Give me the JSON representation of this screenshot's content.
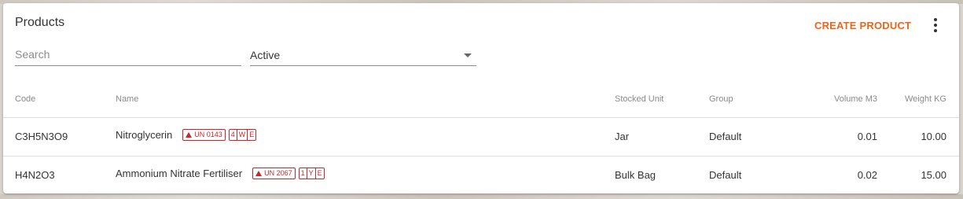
{
  "header": {
    "title": "Products",
    "create_label": "CREATE PRODUCT",
    "more_icon": "more-vertical-icon"
  },
  "filters": {
    "search_placeholder": "Search",
    "search_value": "",
    "status_value": "Active"
  },
  "columns": {
    "code": "Code",
    "name": "Name",
    "stocked_unit": "Stocked Unit",
    "group": "Group",
    "volume": "Volume M3",
    "weight": "Weight KG"
  },
  "rows": [
    {
      "code": "C3H5N3O9",
      "name": "Nitroglycerin",
      "un_badge": "UN 0143",
      "hazard_codes": [
        "4",
        "W",
        "E"
      ],
      "stocked_unit": "Jar",
      "group": "Default",
      "volume": "0.01",
      "weight": "10.00"
    },
    {
      "code": "H4N2O3",
      "name": "Ammonium Nitrate Fertiliser",
      "un_badge": "UN 2067",
      "hazard_codes": [
        "1",
        "Y",
        "E"
      ],
      "stocked_unit": "Bulk Bag",
      "group": "Default",
      "volume": "0.02",
      "weight": "15.00"
    }
  ],
  "colors": {
    "accent": "#e8671b",
    "hazard": "#c9262c"
  }
}
